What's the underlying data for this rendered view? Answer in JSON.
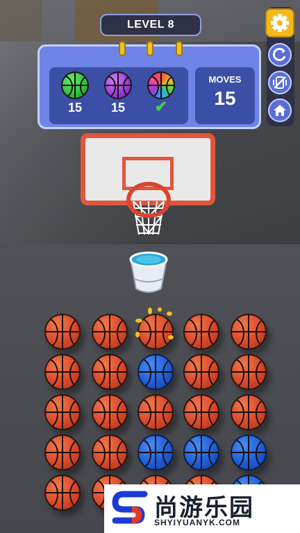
{
  "header": {
    "level_label": "LEVEL 8"
  },
  "goals": {
    "items": [
      {
        "color": "green",
        "count": "15",
        "hex": "#2fbf3a"
      },
      {
        "color": "purple",
        "count": "15",
        "hex": "#9a3ad6"
      },
      {
        "color": "rainbow",
        "count": "",
        "done": true,
        "check": "✔"
      }
    ],
    "moves_label": "MOVES",
    "moves_value": "15"
  },
  "side_buttons": [
    "gear-icon",
    "restart-icon",
    "vibration-off-icon",
    "home-icon"
  ],
  "board": {
    "columns": 5,
    "rows": [
      [
        "orange",
        "orange",
        "orange",
        "orange",
        "orange"
      ],
      [
        "orange",
        "orange",
        "blue",
        "orange",
        "orange"
      ],
      [
        "orange",
        "orange",
        "orange",
        "orange",
        "orange"
      ],
      [
        "orange",
        "orange",
        "blue",
        "blue",
        "blue"
      ],
      [
        "orange",
        "orange",
        "orange",
        "orange",
        "blue"
      ]
    ]
  },
  "watermark": {
    "chinese": "尚游乐园",
    "english": "SHYIYUANYK.COM"
  }
}
